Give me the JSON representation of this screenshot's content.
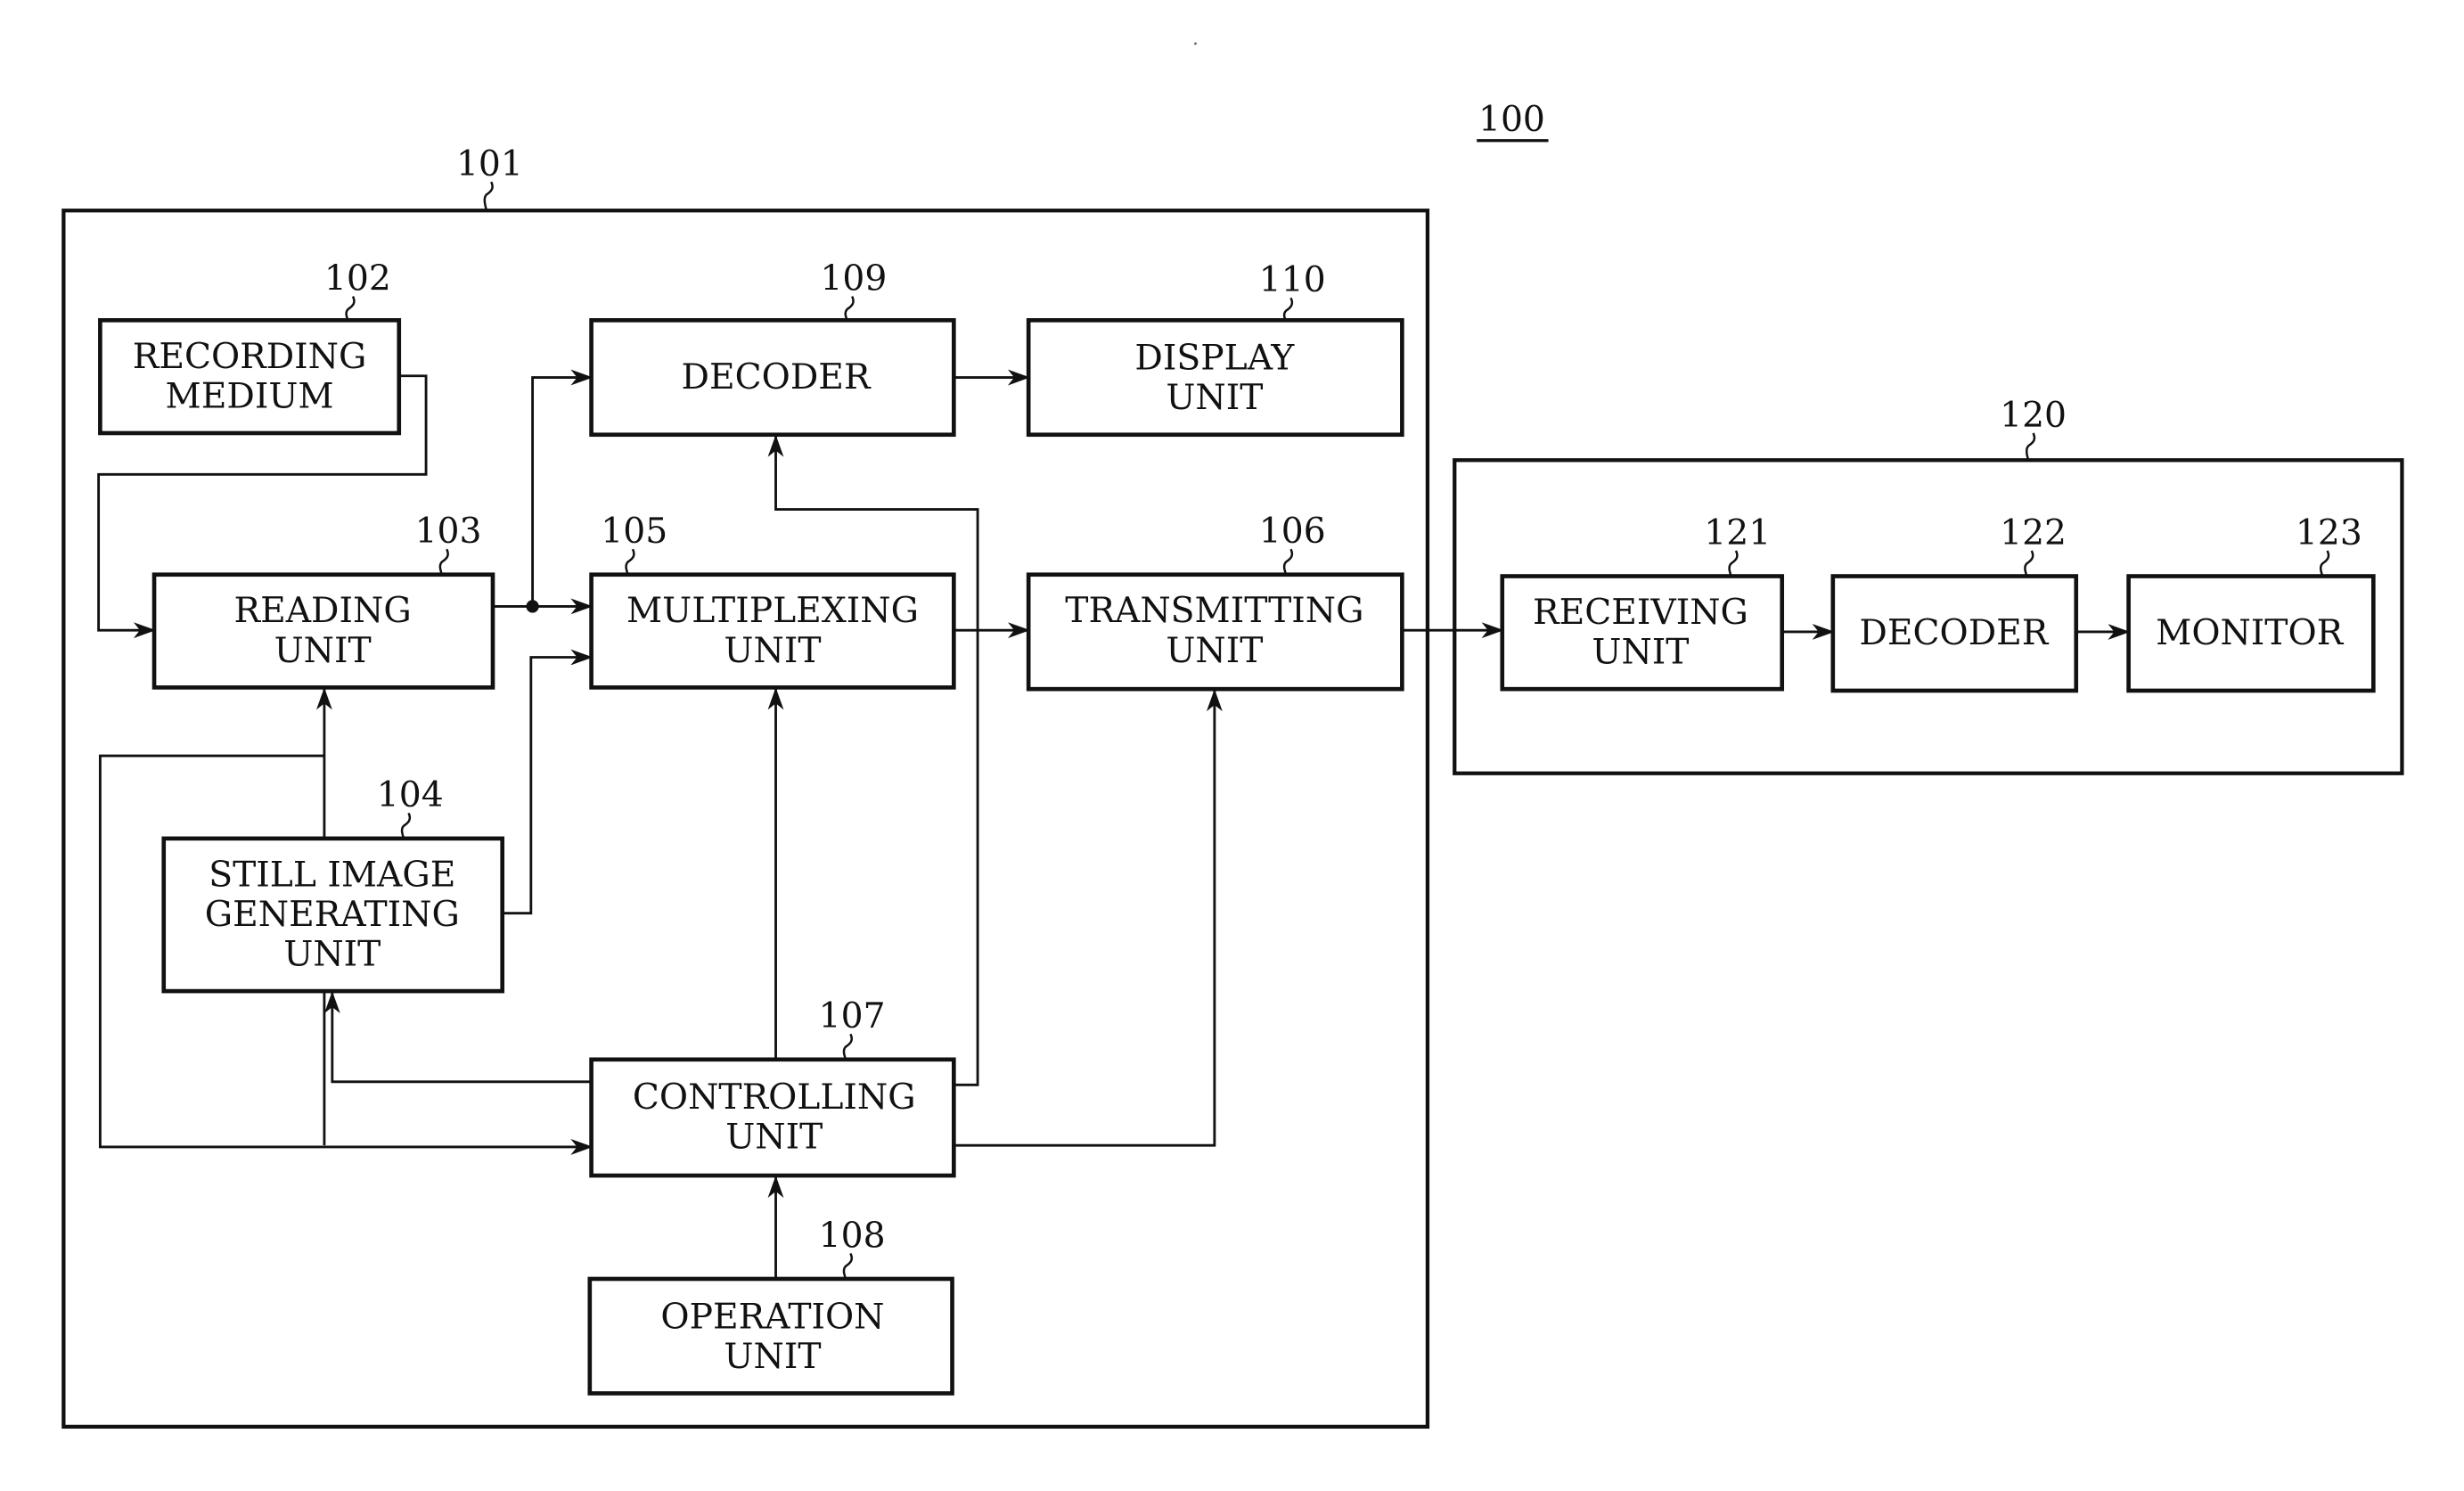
{
  "figure": {
    "system_ref": "100",
    "outer_blocks": [
      {
        "id": "101",
        "ref": "101"
      },
      {
        "id": "120",
        "ref": "120"
      }
    ],
    "blocks": {
      "b102": {
        "ref": "102",
        "lines": [
          "RECORDING",
          "MEDIUM"
        ]
      },
      "b103": {
        "ref": "103",
        "lines": [
          "READING",
          "UNIT"
        ]
      },
      "b104": {
        "ref": "104",
        "lines": [
          "STILL IMAGE",
          "GENERATING",
          "UNIT"
        ]
      },
      "b105": {
        "ref": "105",
        "lines": [
          "MULTIPLEXING",
          "UNIT"
        ]
      },
      "b106": {
        "ref": "106",
        "lines": [
          "TRANSMITTING",
          "UNIT"
        ]
      },
      "b107": {
        "ref": "107",
        "lines": [
          "CONTROLLING",
          "UNIT"
        ]
      },
      "b108": {
        "ref": "108",
        "lines": [
          "OPERATION",
          "UNIT"
        ]
      },
      "b109": {
        "ref": "109",
        "lines": [
          "DECODER"
        ]
      },
      "b110": {
        "ref": "110",
        "lines": [
          "DISPLAY",
          "UNIT"
        ]
      },
      "b121": {
        "ref": "121",
        "lines": [
          "RECEIVING",
          "UNIT"
        ]
      },
      "b122": {
        "ref": "122",
        "lines": [
          "DECODER"
        ]
      },
      "b123": {
        "ref": "123",
        "lines": [
          "MONITOR"
        ]
      }
    },
    "connections": [
      {
        "from": "102",
        "to": "103"
      },
      {
        "from": "103",
        "to": "105"
      },
      {
        "from": "103",
        "to": "109"
      },
      {
        "from": "104",
        "to": "105"
      },
      {
        "from": "105",
        "to": "106"
      },
      {
        "from": "109",
        "to": "110"
      },
      {
        "from": "107",
        "to": "109"
      },
      {
        "from": "107",
        "to": "105"
      },
      {
        "from": "107",
        "to": "106"
      },
      {
        "from": "107",
        "to": "104"
      },
      {
        "from": "107",
        "to": "103"
      },
      {
        "from": "108",
        "to": "107"
      },
      {
        "from": "106",
        "to": "121"
      },
      {
        "from": "121",
        "to": "122"
      },
      {
        "from": "122",
        "to": "123"
      }
    ]
  }
}
